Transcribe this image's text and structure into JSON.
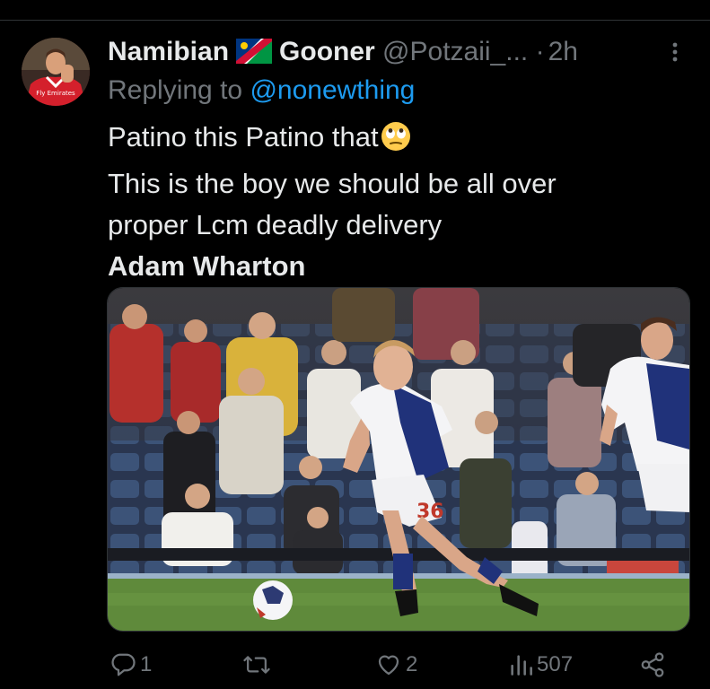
{
  "tweet": {
    "author_name_part1": "Namibian",
    "author_name_part2": "Gooner",
    "handle": "@Potzaii_...",
    "separator": "·",
    "time": "2h",
    "reply_prefix": "Replying to",
    "reply_mention": "@nonewthing",
    "body_lines": [
      "Patino this Patino that",
      "This is the boy we should be all over",
      "proper Lcm deadly delivery",
      "Adam Wharton"
    ],
    "emoji": "eye-roll-emoji",
    "player_shirt_number": "36"
  },
  "actions": {
    "reply_count": "1",
    "retweet_count": "",
    "like_count": "2",
    "views_count": "507"
  },
  "icons": [
    "avatar",
    "namibia-flag-icon",
    "more-icon",
    "eye-roll-emoji-icon",
    "reply-icon",
    "retweet-icon",
    "like-icon",
    "views-icon",
    "share-icon"
  ],
  "colors": {
    "background": "#000000",
    "text": "#e7e9ea",
    "muted": "#71767b",
    "link": "#1d9bf0"
  }
}
